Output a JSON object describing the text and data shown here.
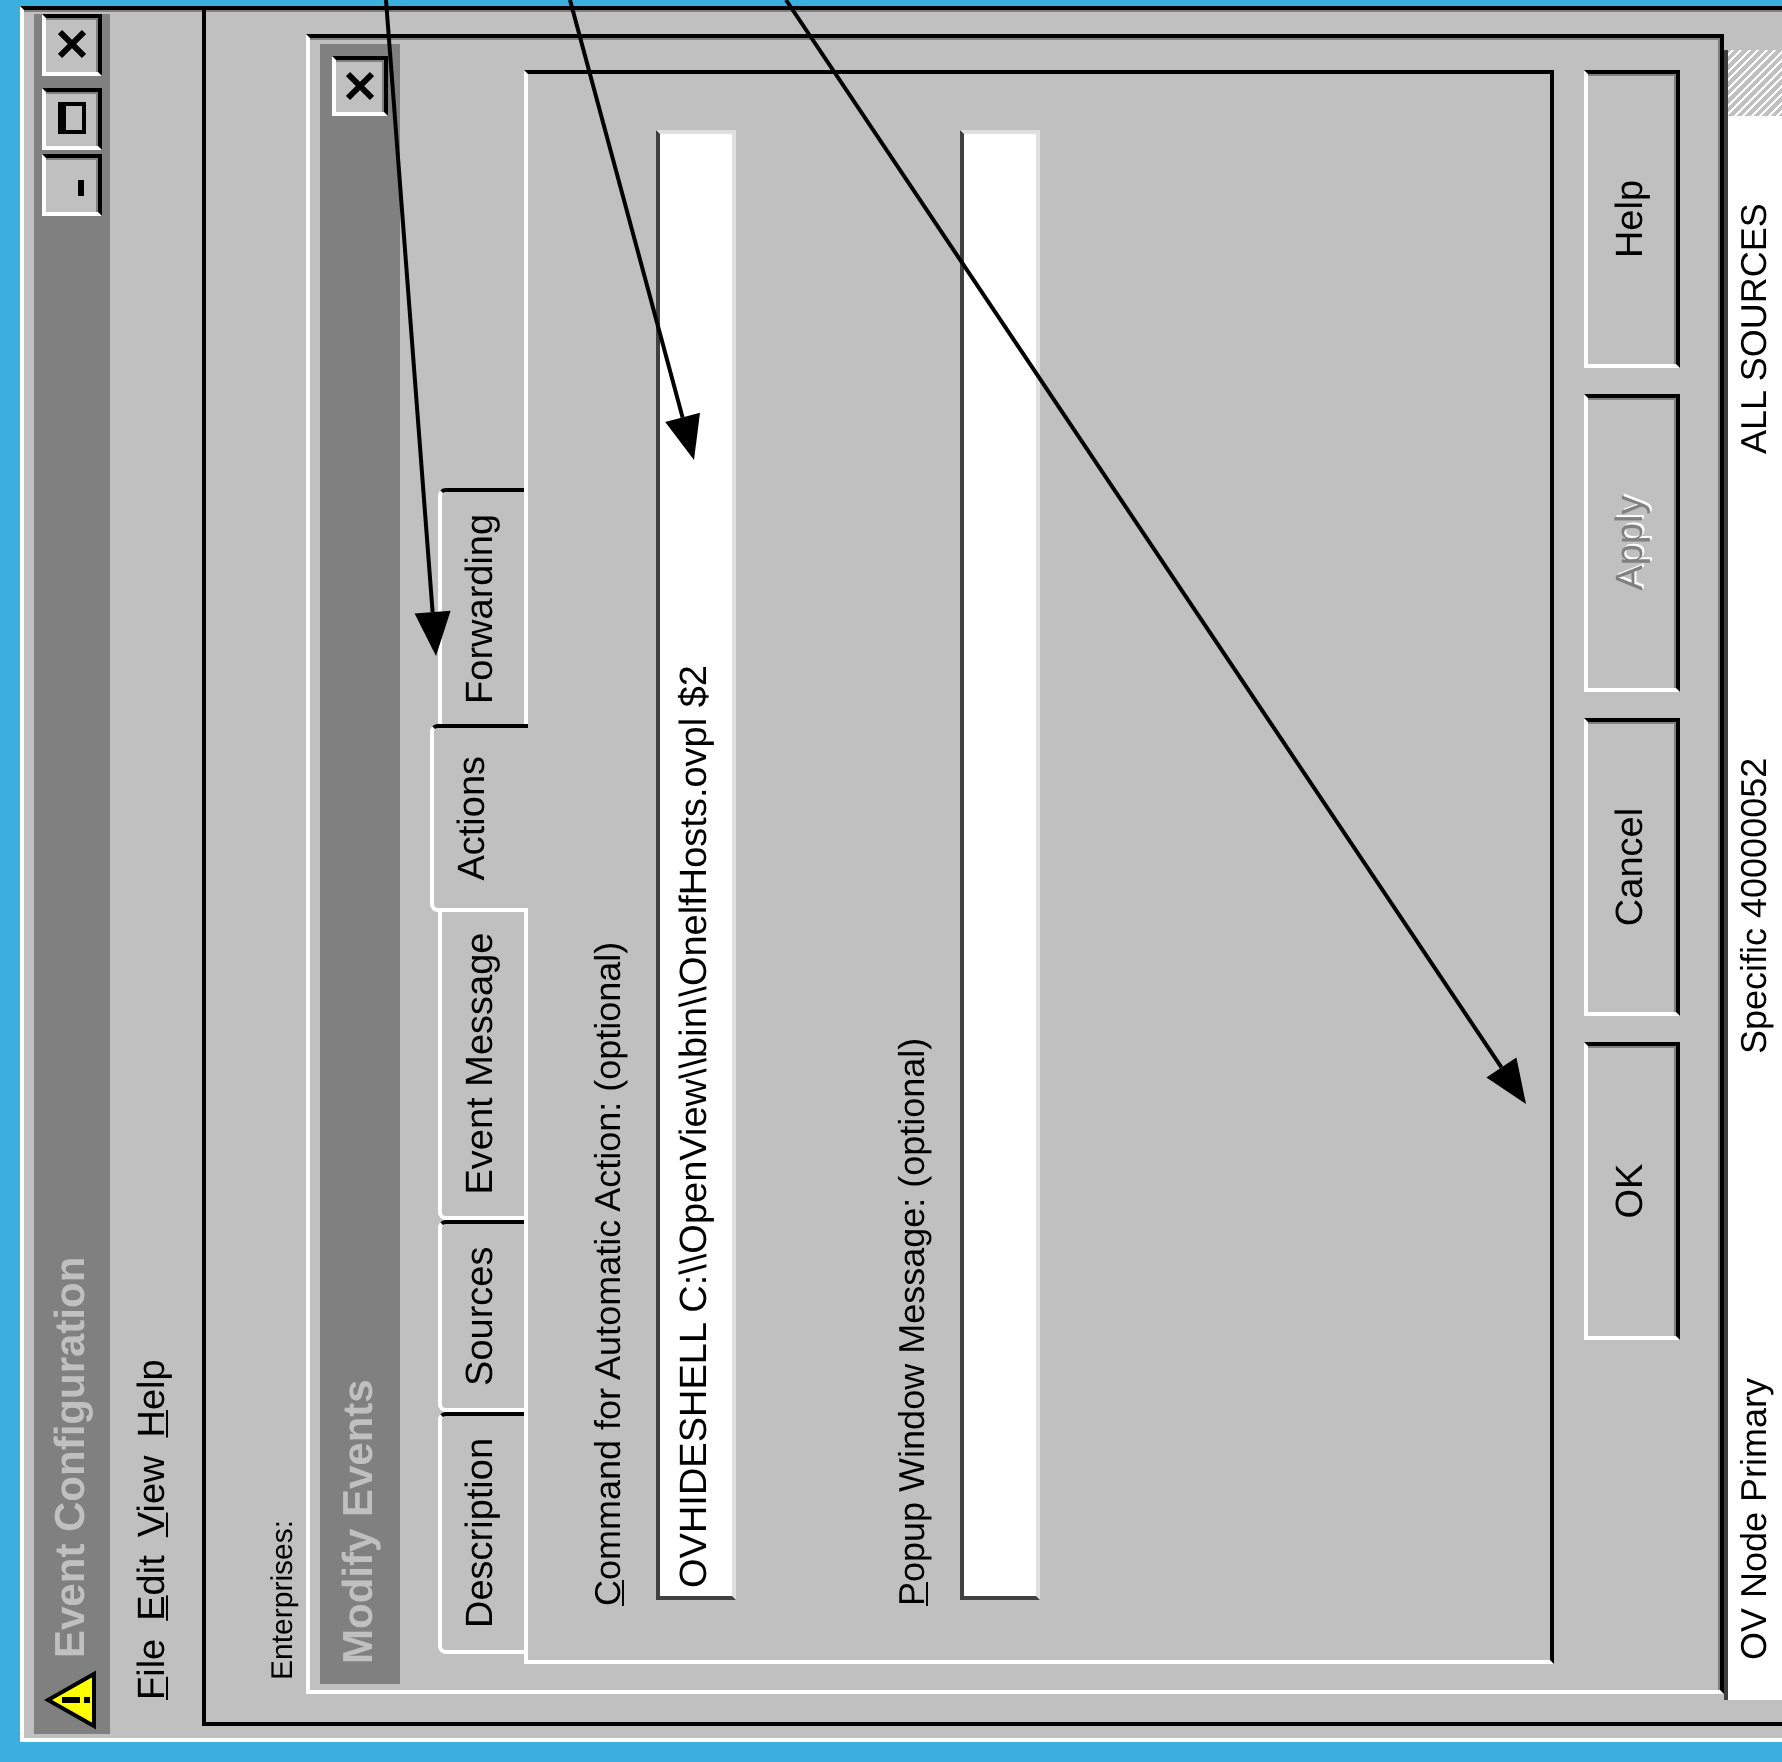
{
  "window": {
    "title": "Event Configuration"
  },
  "menu": [
    {
      "label": "File"
    },
    {
      "label": "Edit"
    },
    {
      "label": "View"
    },
    {
      "label": "Help"
    }
  ],
  "enterprises_label": "Enterprises:",
  "dialog": {
    "title": "Modify Events",
    "tabs": [
      {
        "label": "Description",
        "selected": false
      },
      {
        "label": "Sources",
        "selected": false
      },
      {
        "label": "Event Message",
        "selected": false
      },
      {
        "label": "Actions",
        "selected": true
      },
      {
        "label": "Forwarding",
        "selected": false
      }
    ],
    "fields": [
      {
        "label": "Command for Automatic Action: (optional)",
        "value": "OVHIDESHELL C:\\\\OpenView\\\\bin\\\\OnelfHosts.ovpl $2"
      },
      {
        "label": "Popup Window Message: (optional)"
      }
    ],
    "buttons": [
      {
        "label": "OK",
        "disabled": false
      },
      {
        "label": "Cancel",
        "disabled": false
      },
      {
        "label": "Apply",
        "disabled": true
      },
      {
        "label": "Help",
        "disabled": false
      }
    ]
  },
  "events_table": {
    "rows": [
      {
        "cells": [
          "OV Node Primary",
          "Specific 40000052",
          "ALL SOURCES"
        ]
      }
    ]
  }
}
